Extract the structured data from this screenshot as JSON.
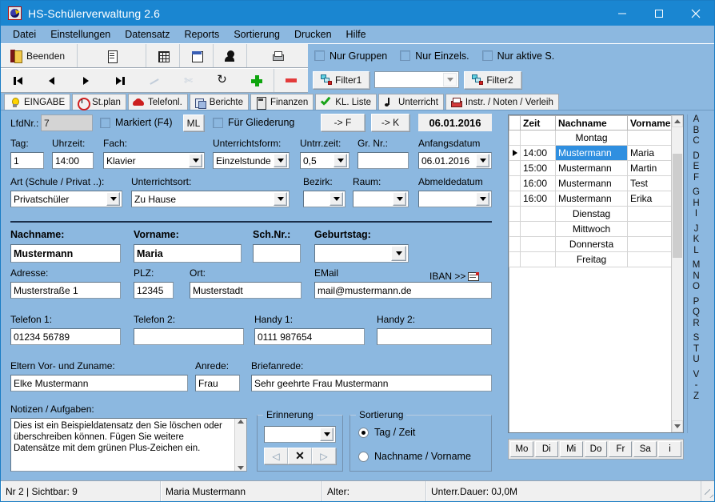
{
  "window": {
    "title": "HS-Schülerverwaltung 2.6",
    "icon": "app-icon",
    "minimize": "–",
    "maximize": "□",
    "close": "✕"
  },
  "menu": [
    "Datei",
    "Einstellungen",
    "Datensatz",
    "Reports",
    "Sortierung",
    "Drucken",
    "Hilfe"
  ],
  "toolbar": {
    "exit_label": "Beenden",
    "icons": [
      "exit-door-icon",
      "document-icon",
      "table-icon",
      "calendar-icon",
      "person-icon",
      "printer-icon"
    ],
    "nav": [
      "first-record",
      "previous-record",
      "next-record",
      "last-record",
      "post-edit",
      "cancel-edit",
      "refresh",
      "add-record",
      "delete-record"
    ]
  },
  "filters": {
    "checkboxes": [
      {
        "label": "Nur Gruppen",
        "checked": false
      },
      {
        "label": "Nur Einzels.",
        "checked": false
      },
      {
        "label": "Nur aktive S.",
        "checked": false
      }
    ],
    "filter1_label": "Filter1",
    "filter2_label": "Filter2",
    "filter_combo_value": ""
  },
  "tabs": [
    {
      "label": "EINGABE",
      "icon": "bulb-icon",
      "active": true
    },
    {
      "label": "St.plan",
      "icon": "clock-icon",
      "active": false
    },
    {
      "label": "Telefonl.",
      "icon": "phone-icon",
      "active": false
    },
    {
      "label": "Berichte",
      "icon": "report-icon",
      "active": false
    },
    {
      "label": "Finanzen",
      "icon": "calculator-icon",
      "active": false
    },
    {
      "label": "KL. Liste",
      "icon": "checkmark-icon",
      "active": false
    },
    {
      "label": "Unterricht",
      "icon": "music-note-icon",
      "active": false
    },
    {
      "label": "Instr. / Noten / Verleih",
      "icon": "red-printer-icon",
      "active": false
    }
  ],
  "form": {
    "lfdnr_label": "LfdNr.:",
    "lfdnr_value": "7",
    "markiert_label": "Markiert (F4)",
    "markiert_checked": false,
    "ml_button": "ML",
    "gliederung_label": "Für Gliederung",
    "gliederung_checked": false,
    "to_f_button": "-> F",
    "to_k_button": "-> K",
    "date_display": "06.01.2016",
    "tag_label": "Tag:",
    "tag_value": "1",
    "uhrzeit_label": "Uhrzeit:",
    "uhrzeit_value": "14:00",
    "fach_label": "Fach:",
    "fach_value": "Klavier",
    "unterrichtsform_label": "Unterrichtsform:",
    "unterrichtsform_value": "Einzelstunde",
    "untrrzeit_label": "Untrr.zeit:",
    "untrrzeit_value": "0,5",
    "grnr_label": "Gr. Nr.:",
    "grnr_value": "",
    "anfangsdatum_label": "Anfangsdatum",
    "anfangsdatum_value": "06.01.2016",
    "art_label": "Art (Schule / Privat ..):",
    "art_value": "Privatschüler",
    "unterrichtsort_label": "Unterrichtsort:",
    "unterrichtsort_value": "Zu Hause",
    "bezirk_label": "Bezirk:",
    "bezirk_value": "",
    "raum_label": "Raum:",
    "raum_value": "",
    "abmeldedatum_label": "Abmeldedatum",
    "abmeldedatum_value": "",
    "nachname_label": "Nachname:",
    "nachname_value": "Mustermann",
    "vorname_label": "Vorname:",
    "vorname_value": "Maria",
    "schnr_label": "Sch.Nr.:",
    "schnr_value": "",
    "geburtstag_label": "Geburtstag:",
    "geburtstag_value": "",
    "adresse_label": "Adresse:",
    "adresse_value": "Musterstraße 1",
    "plz_label": "PLZ:",
    "plz_value": "12345",
    "ort_label": "Ort:",
    "ort_value": "Musterstadt",
    "email_label": "EMail",
    "email_value": "mail@mustermann.de",
    "iban_label": "IBAN >>",
    "telefon1_label": "Telefon 1:",
    "telefon1_value": "01234 56789",
    "telefon2_label": "Telefon 2:",
    "telefon2_value": "",
    "handy1_label": "Handy 1:",
    "handy1_value": "0111 987654",
    "handy2_label": "Handy 2:",
    "handy2_value": "",
    "eltern_label": "Eltern Vor- und Zuname:",
    "eltern_value": "Elke Mustermann",
    "anrede_label": "Anrede:",
    "anrede_value": "Frau",
    "briefanrede_label": "Briefanrede:",
    "briefanrede_value": "Sehr geehrte Frau Mustermann",
    "notizen_label": "Notizen / Aufgaben:",
    "notizen_value": "Dies ist ein Beispieldatensatz den Sie löschen oder überschreiben können. Fügen Sie weitere Datensätze mit dem grünen Plus-Zeichen ein."
  },
  "erinnerung": {
    "title": "Erinnerung",
    "value": "",
    "prev_label": "◁",
    "clear_label": "✕",
    "next_label": "▷"
  },
  "sortierung": {
    "title": "Sortierung",
    "options": [
      {
        "label": "Tag / Zeit",
        "selected": true
      },
      {
        "label": "Nachname / Vorname",
        "selected": false
      }
    ]
  },
  "grid": {
    "headers": [
      "",
      "Zeit",
      "Nachname",
      "Vorname"
    ],
    "rows": [
      {
        "marker": "",
        "zeit": "",
        "nachname": "Montag",
        "vorname": "",
        "day": true,
        "selected": false
      },
      {
        "marker": "▶",
        "zeit": "14:00",
        "nachname": "Mustermann",
        "vorname": "Maria",
        "day": false,
        "selected": true
      },
      {
        "marker": "",
        "zeit": "15:00",
        "nachname": "Mustermann",
        "vorname": "Martin",
        "day": false,
        "selected": false
      },
      {
        "marker": "",
        "zeit": "16:00",
        "nachname": "Mustermann",
        "vorname": "Test",
        "day": false,
        "selected": false
      },
      {
        "marker": "",
        "zeit": "16:00",
        "nachname": "Mustermann",
        "vorname": "Erika",
        "day": false,
        "selected": false
      },
      {
        "marker": "",
        "zeit": "",
        "nachname": "Dienstag",
        "vorname": "",
        "day": true,
        "selected": false
      },
      {
        "marker": "",
        "zeit": "",
        "nachname": "Mittwoch",
        "vorname": "",
        "day": true,
        "selected": false
      },
      {
        "marker": "",
        "zeit": "",
        "nachname": "Donnersta",
        "vorname": "",
        "day": true,
        "selected": false
      },
      {
        "marker": "",
        "zeit": "",
        "nachname": "Freitag",
        "vorname": "",
        "day": true,
        "selected": false
      }
    ]
  },
  "alphabet": [
    "A",
    "B",
    "C",
    "",
    "D",
    "E",
    "F",
    "",
    "G",
    "H",
    "I",
    "",
    "J",
    "K",
    "L",
    "",
    "M",
    "N",
    "O",
    "",
    "P",
    "Q",
    "R",
    "",
    "S",
    "T",
    "U",
    "",
    "V",
    "-",
    "Z"
  ],
  "daybuttons": [
    "Mo",
    "Di",
    "Mi",
    "Do",
    "Fr",
    "Sa",
    "i"
  ],
  "statusbar": {
    "record": "Nr 2  | Sichtbar: 9",
    "name": "Maria Mustermann",
    "alter": "Alter:",
    "dauer": "Unterr.Dauer: 0J,0M"
  },
  "colors": {
    "titlebar": "#1a86d1",
    "form_background": "#8cb8e0",
    "selection": "#2f8fe0",
    "accent_green": "#0ea50e",
    "accent_red": "#e33b3b"
  }
}
